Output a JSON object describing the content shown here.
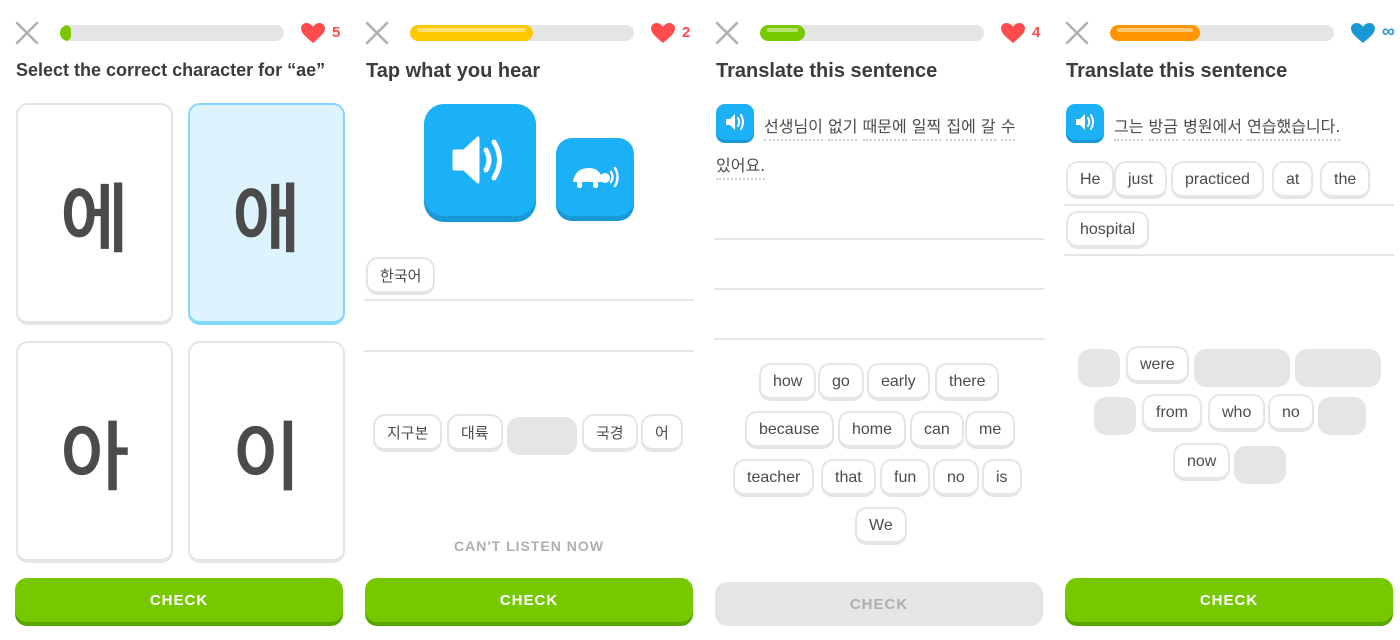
{
  "colors": {
    "green": "#78c800",
    "yellow": "#ffc800",
    "orange": "#ff9600",
    "blue": "#1cb0f6",
    "red_heart": "#ff4b4b",
    "blue_heart": "#1899d6",
    "selected_bg": "#ddf4ff",
    "selected_border": "#84d8ff"
  },
  "screens": [
    {
      "progress_percent": 5,
      "progress_color": "#78c800",
      "heart_icon": "heart-icon",
      "hearts": "5",
      "prompt": "Select the correct character for “ae”",
      "options": [
        "에",
        "애",
        "아",
        "이"
      ],
      "selected_option": 1,
      "check_label": "CHECK"
    },
    {
      "progress_percent": 55,
      "progress_color": "#ffc800",
      "heart_icon": "heart-icon",
      "hearts": "2",
      "prompt": "Tap what you hear",
      "answer_tiles": [
        "한국어"
      ],
      "word_bank": [
        "지구본",
        "대륙",
        "",
        "국경",
        "어"
      ],
      "cant_listen": "CAN'T LISTEN NOW",
      "check_label": "CHECK"
    },
    {
      "progress_percent": 20,
      "progress_color": "#78c800",
      "heart_icon": "heart-icon",
      "hearts": "4",
      "prompt": "Translate this sentence",
      "sentence_line1": [
        "선생님이",
        "없기",
        "때문에",
        "일찍",
        "집에",
        "갈",
        "수"
      ],
      "sentence_line2": [
        "있어요."
      ],
      "word_bank": [
        "how",
        "go",
        "early",
        "there",
        "because",
        "home",
        "can",
        "me",
        "teacher",
        "that",
        "fun",
        "no",
        "is",
        "We"
      ],
      "check_label": "CHECK"
    },
    {
      "progress_percent": 40,
      "progress_color": "#ff9600",
      "heart_icon": "heart-blue-icon",
      "hearts": "∞",
      "prompt": "Translate this sentence",
      "sentence_line1": [
        "그는",
        "방금",
        "병원에서",
        "연습했습니다."
      ],
      "answer_tiles": [
        "He",
        "just",
        "practiced",
        "at",
        "the",
        "hospital"
      ],
      "word_bank": [
        "",
        "were",
        "",
        "",
        "",
        "from",
        "who",
        "no",
        "",
        "now",
        ""
      ],
      "check_label": "CHECK"
    }
  ]
}
